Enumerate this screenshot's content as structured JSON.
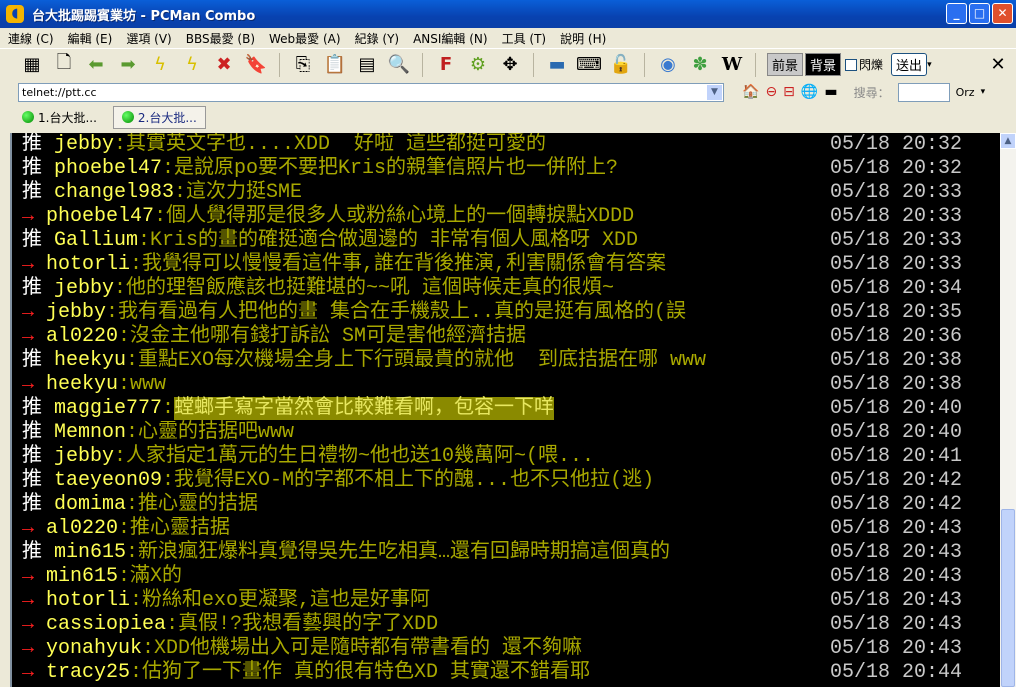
{
  "window": {
    "title": "台大批踢踢賓業坊 - PCMan Combo"
  },
  "menu": [
    "連線 (C)",
    "編輯 (E)",
    "選項 (V)",
    "BBS最愛 (B)",
    "Web最愛 (A)",
    "紀錄 (Y)",
    "ANSI編輯 (N)",
    "工具 (T)",
    "說明 (H)"
  ],
  "toolbar": {
    "fg_label": "前景",
    "bg_label": "背景",
    "blink_label": "閃爍",
    "send_label": "送出"
  },
  "address": {
    "value": "telnet://ptt.cc"
  },
  "search": {
    "label": "搜尋：",
    "engine": "Orz"
  },
  "tabs": [
    {
      "label": "1.台大批..."
    },
    {
      "label": "2.台大批..."
    }
  ],
  "rows": [
    {
      "mark": "推",
      "user": "jebby",
      "msg": ":其實英文字也....XDD  好啦 這些都挺可愛的",
      "date": "05/18 20:32"
    },
    {
      "mark": "推",
      "user": "phoebel47",
      "msg": ":是說原po要不要把Kris的親筆信照片也一併附上?",
      "date": "05/18 20:32"
    },
    {
      "mark": "推",
      "user": "changel983",
      "msg": ":這次力挺SME",
      "date": "05/18 20:33"
    },
    {
      "mark": "→",
      "user": "phoebel47",
      "msg": ":個人覺得那是很多人或粉絲心境上的一個轉捩點XDDD",
      "date": "05/18 20:33"
    },
    {
      "mark": "推",
      "user": "Gallium",
      "msg": ":Kris的畫的確挺適合做週邊的 非常有個人風格呀 XDD",
      "date": "05/18 20:33"
    },
    {
      "mark": "→",
      "user": "hotorli",
      "msg": ":我覺得可以慢慢看這件事,誰在背後推演,利害關係會有答案",
      "date": "05/18 20:33"
    },
    {
      "mark": "推",
      "user": "jebby",
      "msg": ":他的理智飯應該也挺難堪的~~吼 這個時候走真的很煩~",
      "date": "05/18 20:34"
    },
    {
      "mark": "→",
      "user": "jebby",
      "msg": ":我有看過有人把他的畫 集合在手機殼上..真的是挺有風格的(誤",
      "date": "05/18 20:35"
    },
    {
      "mark": "→",
      "user": "al0220",
      "msg": ":沒金主他哪有錢打訴訟 SM可是害他經濟拮据",
      "date": "05/18 20:36"
    },
    {
      "mark": "推",
      "user": "heekyu",
      "msg": ":重點EXO每次機場全身上下行頭最貴的就他  到底拮据在哪 www",
      "date": "05/18 20:38"
    },
    {
      "mark": "→",
      "user": "heekyu",
      "msg": ":www",
      "date": "05/18 20:38"
    },
    {
      "mark": "推",
      "user": "maggie777",
      "msg": "螳螂手寫字當然會比較難看啊，包容一下咩",
      "highlight": true,
      "date": "05/18 20:40"
    },
    {
      "mark": "推",
      "user": "Memnon",
      "msg": ":心靈的拮据吧www",
      "date": "05/18 20:40"
    },
    {
      "mark": "推",
      "user": "jebby",
      "msg": ":人家指定1萬元的生日禮物~他也送10幾萬阿~(喂...",
      "date": "05/18 20:41"
    },
    {
      "mark": "推",
      "user": "taeyeon09",
      "msg": ":我覺得EXO-M的字都不相上下的醜...也不只他拉(逃)",
      "date": "05/18 20:42"
    },
    {
      "mark": "推",
      "user": "domima",
      "msg": ":推心靈的拮据",
      "date": "05/18 20:42"
    },
    {
      "mark": "→",
      "user": "al0220",
      "msg": ":推心靈拮据",
      "date": "05/18 20:43"
    },
    {
      "mark": "推",
      "user": "min615",
      "msg": ":新浪瘋狂爆料真覺得吳先生吃相真…還有回歸時期搞這個真的",
      "date": "05/18 20:43"
    },
    {
      "mark": "→",
      "user": "min615",
      "msg": ":滿X的",
      "date": "05/18 20:43"
    },
    {
      "mark": "→",
      "user": "hotorli",
      "msg": ":粉絲和exo更凝聚,這也是好事阿",
      "date": "05/18 20:43"
    },
    {
      "mark": "→",
      "user": "cassiopiea",
      "msg": ":真假!?我想看藝興的字了XDD",
      "date": "05/18 20:43"
    },
    {
      "mark": "→",
      "user": "yonahyuk",
      "msg": ":XDD他機場出入可是隨時都有帶書看的 還不夠嘛",
      "date": "05/18 20:43"
    },
    {
      "mark": "→",
      "user": "tracy25",
      "msg": ":估狗了一下畫作 真的很有特色XD 其實還不錯看耶",
      "date": "05/18 20:44"
    }
  ]
}
